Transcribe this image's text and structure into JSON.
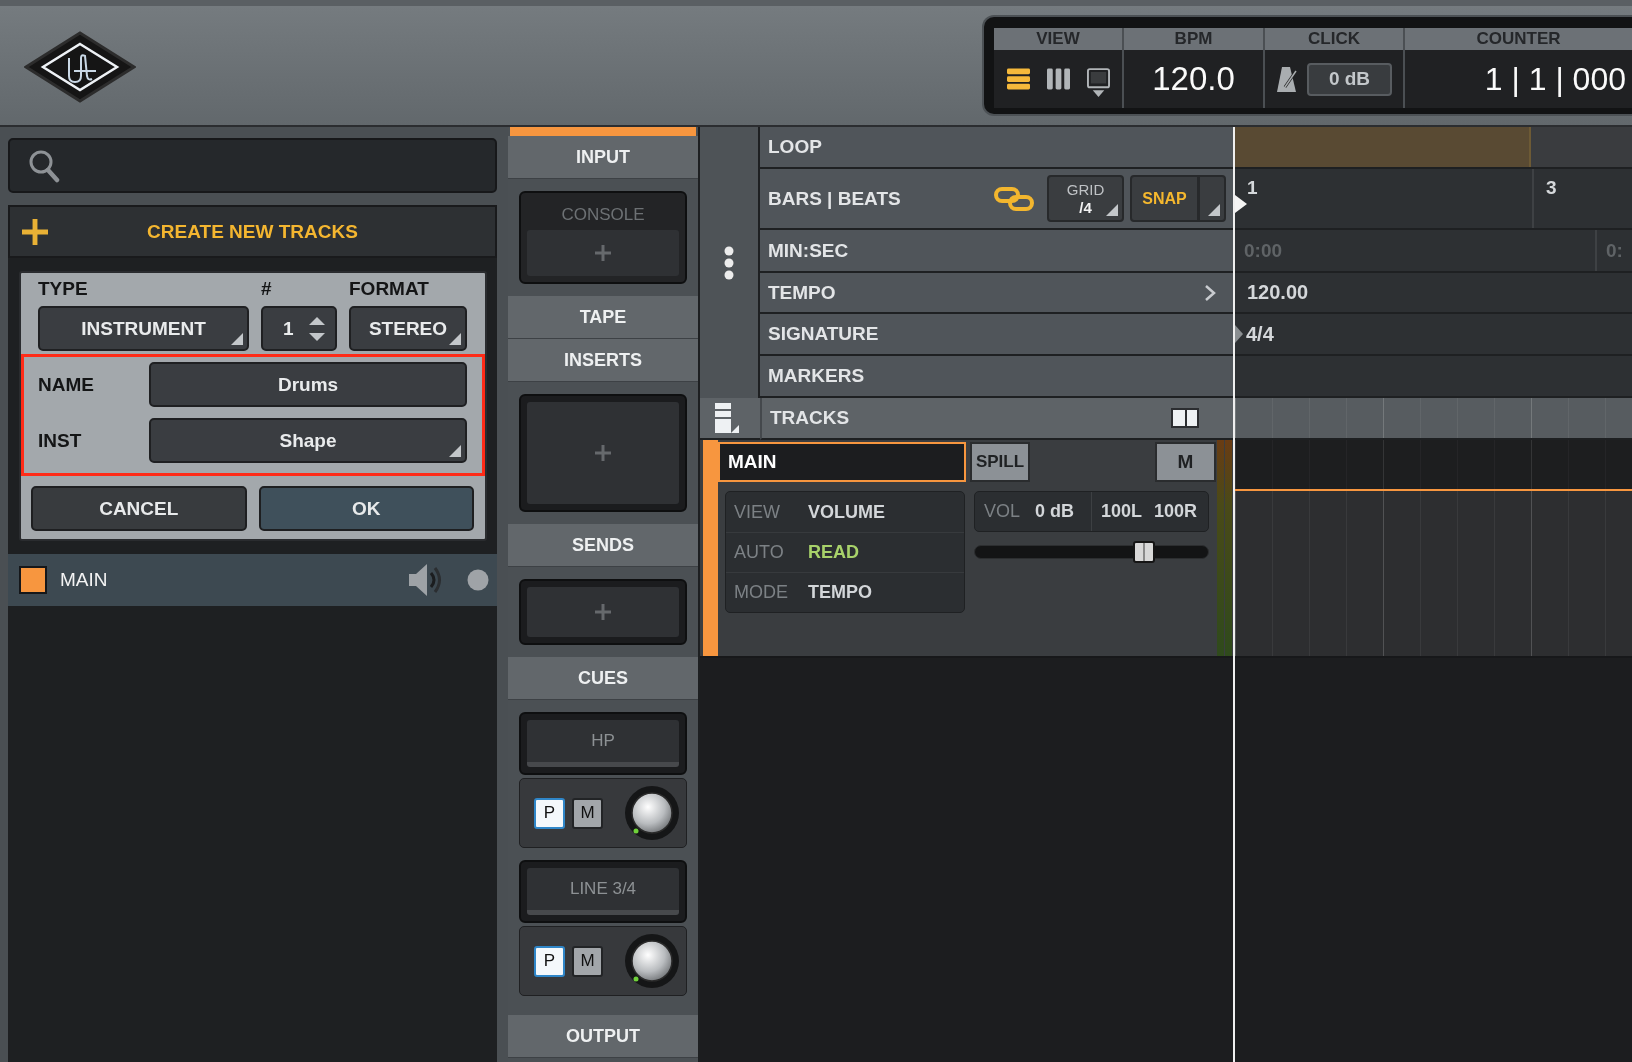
{
  "transport": {
    "view": {
      "label": "VIEW",
      "options": [
        {
          "kind": "list",
          "selected": true
        },
        {
          "kind": "columns",
          "selected": false
        },
        {
          "kind": "monitor",
          "selected": false
        }
      ]
    },
    "bpm": {
      "label": "BPM",
      "value": "120.0"
    },
    "click": {
      "label": "CLICK",
      "value": "0 dB"
    },
    "counter": {
      "label": "COUNTER",
      "value": "1 | 1 | 000"
    }
  },
  "browser": {
    "create_tracks": {
      "title": "CREATE NEW TRACKS",
      "columns": [
        {
          "label": "TYPE",
          "value": "INSTRUMENT",
          "kind": "dropdown"
        },
        {
          "label": "#",
          "value": "1",
          "kind": "stepper"
        },
        {
          "label": "FORMAT",
          "value": "STEREO",
          "kind": "dropdown"
        }
      ],
      "fields": [
        {
          "label": "NAME",
          "value": "Drums",
          "kind": "text"
        },
        {
          "label": "INST",
          "value": "Shape",
          "kind": "dropdown"
        }
      ],
      "fields_highlighted": true,
      "buttons": [
        {
          "label": "CANCEL",
          "kind": "secondary"
        },
        {
          "label": "OK",
          "kind": "primary"
        }
      ]
    },
    "tracks": [
      {
        "name": "MAIN",
        "color": "#f7963f"
      }
    ]
  },
  "channel_strip": {
    "sections": [
      {
        "kind": "header",
        "label": "INPUT"
      },
      {
        "kind": "input",
        "label": "CONSOLE"
      },
      {
        "kind": "header",
        "label": "TAPE"
      },
      {
        "kind": "header",
        "label": "INSERTS"
      },
      {
        "kind": "inserts"
      },
      {
        "kind": "header",
        "label": "SENDS"
      },
      {
        "kind": "sends"
      },
      {
        "kind": "header",
        "label": "CUES"
      },
      {
        "kind": "cue",
        "label": "HP",
        "buttons": [
          {
            "label": "P",
            "on": true
          },
          {
            "label": "M",
            "on": false
          }
        ]
      },
      {
        "kind": "cue",
        "label": "LINE 3/4",
        "buttons": [
          {
            "label": "P",
            "on": true
          },
          {
            "label": "M",
            "on": false
          }
        ]
      },
      {
        "kind": "header",
        "label": "OUTPUT"
      }
    ]
  },
  "timeline": {
    "rows": [
      {
        "kind": "loop",
        "label": "LOOP"
      },
      {
        "kind": "bars",
        "label": "BARS | BEATS",
        "linked": true,
        "grid": {
          "label": "GRID",
          "value": "/4"
        },
        "snap": {
          "label": "SNAP",
          "on": true
        },
        "ticks": [
          "1",
          "3"
        ]
      },
      {
        "kind": "time",
        "label": "MIN:SEC",
        "ticks": [
          "0:00",
          "0:"
        ]
      },
      {
        "kind": "tempo",
        "label": "TEMPO",
        "value": "120.00"
      },
      {
        "kind": "signature",
        "label": "SIGNATURE",
        "value": "4/4"
      },
      {
        "kind": "markers",
        "label": "MARKERS"
      }
    ],
    "tracks_label": "TRACKS",
    "track": {
      "name": "MAIN",
      "selected": true,
      "color": "#f7963f",
      "spill": "SPILL",
      "mute": {
        "label": "M",
        "on": false
      },
      "info": [
        {
          "label": "VIEW",
          "value": "VOLUME",
          "highlighted": false
        },
        {
          "label": "AUTO",
          "value": "READ",
          "highlighted": true
        },
        {
          "label": "MODE",
          "value": "TEMPO",
          "highlighted": false
        }
      ],
      "volume": {
        "label": "VOL",
        "value": "0 dB",
        "pan_left": "100L",
        "pan_right": "100R",
        "level": 0.75
      }
    }
  }
}
